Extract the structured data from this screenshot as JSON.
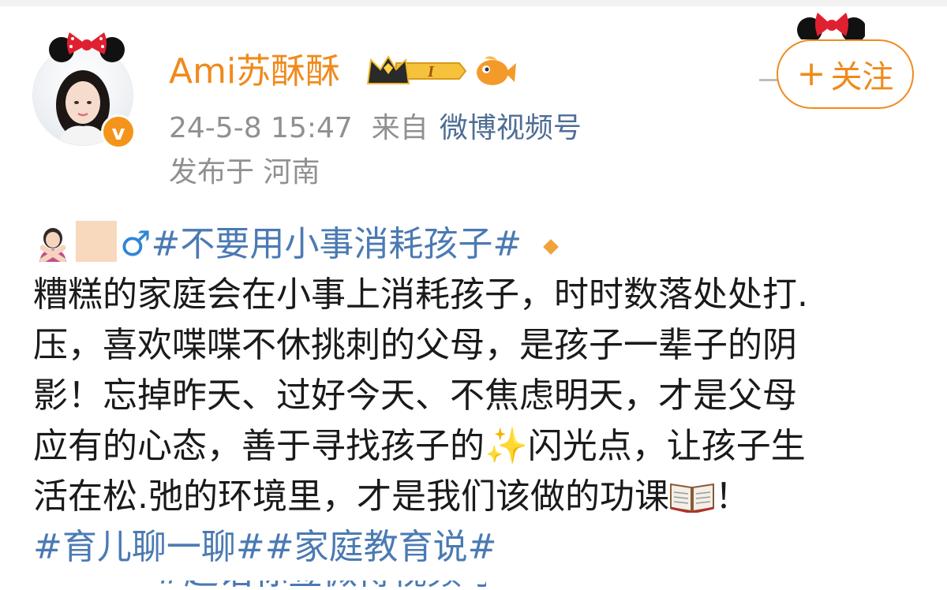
{
  "post": {
    "username": "Ami苏酥酥",
    "level_badge": "I",
    "verify_mark": "v",
    "follow_plus": "+",
    "follow_label": "关注",
    "date": "24-5-8 15:47",
    "from_prefix": "来自",
    "source": "微博视频号",
    "location": "发布于 河南",
    "icons": [
      "minnie-ears-icon",
      "crown-badge-icon",
      "fish-icon",
      "verified-icon",
      "no-gesture-emoji",
      "male-sign-icon",
      "sparkles-emoji",
      "book-emoji"
    ],
    "colors": {
      "accent": "#f08a1c",
      "link": "#4b7ab3",
      "meta": "#909090",
      "source": "#4f6d94"
    }
  },
  "content": {
    "line1_male": "♂",
    "line1_tag": "#不要用小事消耗孩子#",
    "line2": "糟糕的家庭会在小事上消耗孩子，时时数落处处打.",
    "line3": "压，喜欢喋喋不休挑刺的父母，是孩子一辈子的阴",
    "line4": "影！忘掉昨天、过好今天、不焦虑明天，才是父母",
    "line5_a": "应有的心态，善于寻找孩子的",
    "line5_spark": "✨",
    "line5_b": "闪光点，让孩子生",
    "line6_a": "活在松.弛的环境里，才是我们该做的功课",
    "line6_b": "！",
    "line7_tags": "#育儿聊一聊##家庭教育说#",
    "line8_cut": "#超话标签微博视频号"
  }
}
